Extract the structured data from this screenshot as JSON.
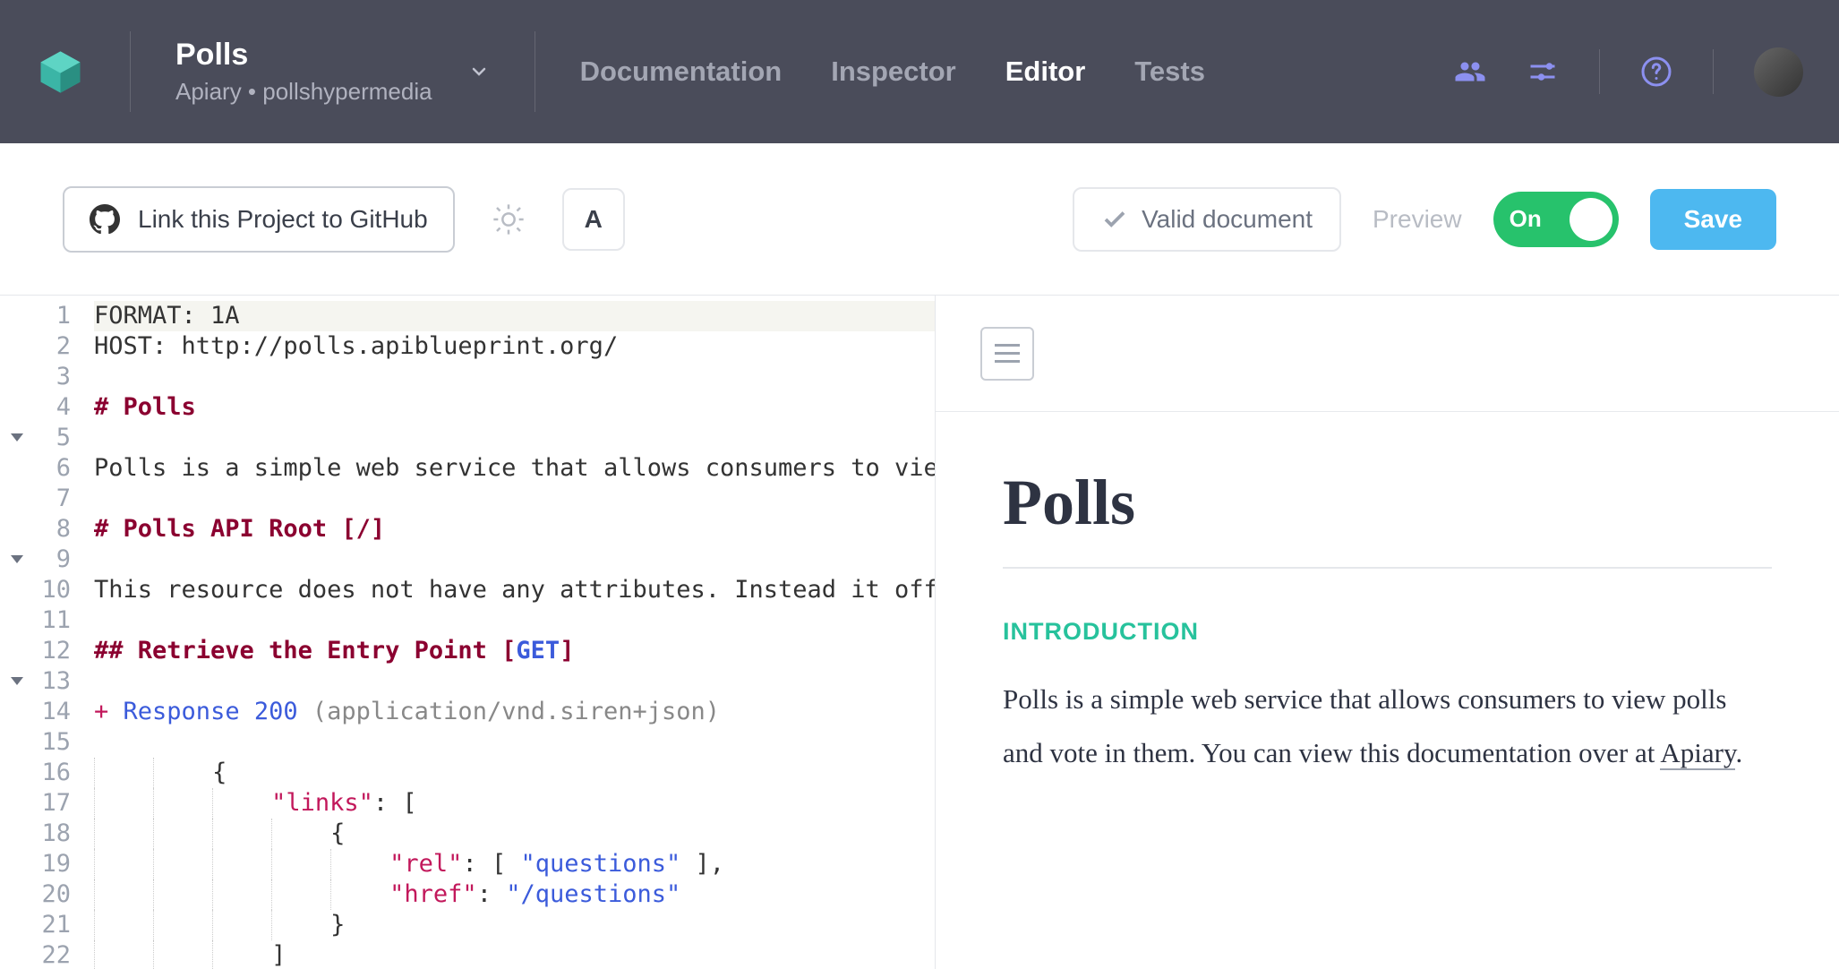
{
  "header": {
    "project_title": "Polls",
    "project_sub": "Apiary • pollshypermedia",
    "nav": {
      "documentation": "Documentation",
      "inspector": "Inspector",
      "editor": "Editor",
      "tests": "Tests"
    }
  },
  "toolbar": {
    "github_label": "Link this Project to GitHub",
    "font_btn": "A",
    "valid_doc": "Valid document",
    "preview_label": "Preview",
    "toggle_label": "On",
    "save_label": "Save"
  },
  "editor": {
    "lines": [
      {
        "n": 1,
        "fold": false,
        "segments": [
          {
            "t": "FORMAT: 1A",
            "c": ""
          }
        ],
        "hl": true
      },
      {
        "n": 2,
        "fold": false,
        "segments": [
          {
            "t": "HOST: http://polls.apiblueprint.org/",
            "c": ""
          }
        ]
      },
      {
        "n": 3,
        "fold": false,
        "segments": [
          {
            "t": "",
            "c": ""
          }
        ]
      },
      {
        "n": 4,
        "fold": true,
        "segments": [
          {
            "t": "# Polls",
            "c": "md-heading"
          }
        ]
      },
      {
        "n": 5,
        "fold": false,
        "segments": [
          {
            "t": "",
            "c": ""
          }
        ]
      },
      {
        "n": 6,
        "fold": false,
        "segments": [
          {
            "t": "Polls is a simple web service that allows consumers to view",
            "c": ""
          }
        ]
      },
      {
        "n": 7,
        "fold": false,
        "segments": [
          {
            "t": "",
            "c": ""
          }
        ]
      },
      {
        "n": 8,
        "fold": true,
        "segments": [
          {
            "t": "# Polls API Root ",
            "c": "md-heading"
          },
          {
            "t": "[/]",
            "c": "md-bracket"
          }
        ]
      },
      {
        "n": 9,
        "fold": false,
        "segments": [
          {
            "t": "",
            "c": ""
          }
        ]
      },
      {
        "n": 10,
        "fold": false,
        "segments": [
          {
            "t": "This resource does not have any attributes. Instead it offe",
            "c": ""
          }
        ]
      },
      {
        "n": 11,
        "fold": false,
        "segments": [
          {
            "t": "",
            "c": ""
          }
        ]
      },
      {
        "n": 12,
        "fold": true,
        "segments": [
          {
            "t": "## Retrieve the Entry Point ",
            "c": "md-heading"
          },
          {
            "t": "[",
            "c": "md-bracket"
          },
          {
            "t": "GET",
            "c": "tok-method"
          },
          {
            "t": "]",
            "c": "md-bracket"
          }
        ]
      },
      {
        "n": 13,
        "fold": false,
        "segments": [
          {
            "t": "",
            "c": ""
          }
        ]
      },
      {
        "n": 14,
        "fold": false,
        "segments": [
          {
            "t": "+",
            "c": "tok-plus"
          },
          {
            "t": " ",
            "c": ""
          },
          {
            "t": "Response",
            "c": "tok-keyword"
          },
          {
            "t": " ",
            "c": ""
          },
          {
            "t": "200",
            "c": "tok-num"
          },
          {
            "t": " (application/vnd.siren+json)",
            "c": "tok-paren"
          }
        ]
      },
      {
        "n": 15,
        "fold": false,
        "segments": [
          {
            "t": "",
            "c": ""
          }
        ]
      },
      {
        "n": 16,
        "fold": false,
        "indent": 2,
        "segments": [
          {
            "t": "{",
            "c": ""
          }
        ]
      },
      {
        "n": 17,
        "fold": false,
        "indent": 3,
        "segments": [
          {
            "t": "\"links\"",
            "c": "tok-string"
          },
          {
            "t": ": [",
            "c": ""
          }
        ]
      },
      {
        "n": 18,
        "fold": false,
        "indent": 4,
        "segments": [
          {
            "t": "{",
            "c": ""
          }
        ]
      },
      {
        "n": 19,
        "fold": false,
        "indent": 5,
        "segments": [
          {
            "t": "\"rel\"",
            "c": "tok-string"
          },
          {
            "t": ": [ ",
            "c": ""
          },
          {
            "t": "\"questions\"",
            "c": "tok-string-b"
          },
          {
            "t": " ],",
            "c": ""
          }
        ]
      },
      {
        "n": 20,
        "fold": false,
        "indent": 5,
        "segments": [
          {
            "t": "\"href\"",
            "c": "tok-string"
          },
          {
            "t": ": ",
            "c": ""
          },
          {
            "t": "\"/questions\"",
            "c": "tok-string-b"
          }
        ]
      },
      {
        "n": 21,
        "fold": false,
        "indent": 4,
        "segments": [
          {
            "t": "}",
            "c": ""
          }
        ]
      },
      {
        "n": 22,
        "fold": false,
        "indent": 3,
        "segments": [
          {
            "t": "]",
            "c": ""
          }
        ]
      }
    ]
  },
  "preview": {
    "title": "Polls",
    "section_label": "INTRODUCTION",
    "body_parts": {
      "p1": "Polls is a simple web service that allows consumers to view polls and vote in them. You can view this documentation over at ",
      "link": "Apiary",
      "p2": "."
    }
  }
}
